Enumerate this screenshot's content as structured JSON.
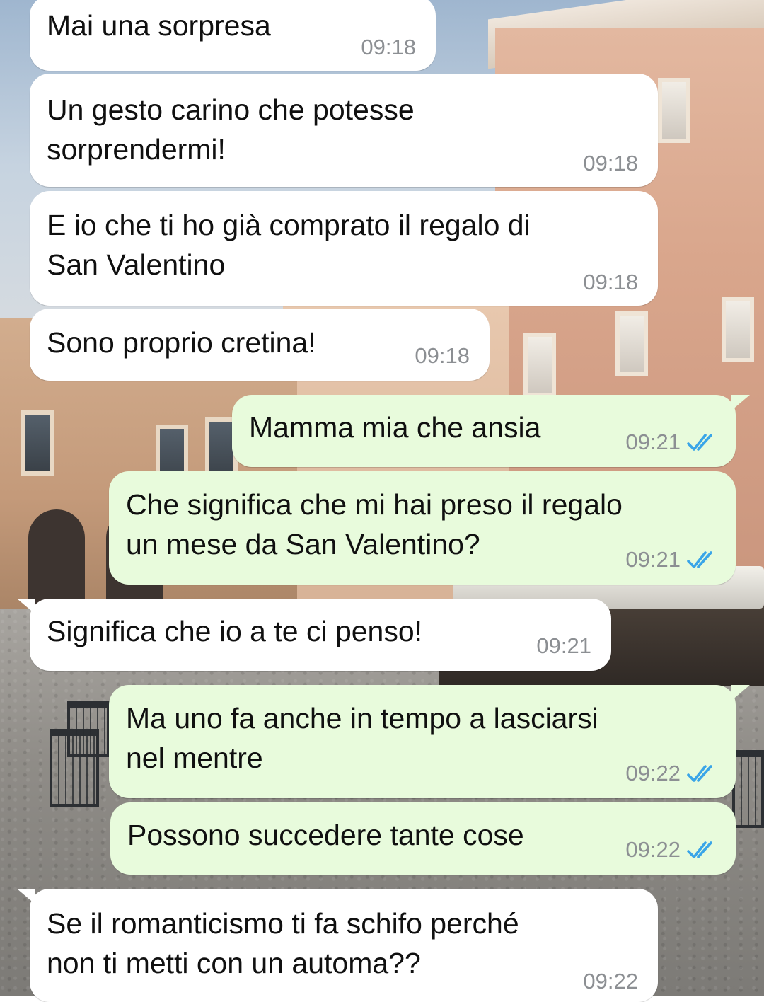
{
  "colors": {
    "incoming_bubble": "#ffffff",
    "outgoing_bubble": "#e8fbdc",
    "timestamp": "#8c8f93",
    "read_ticks": "#3aa5e8"
  },
  "messages": [
    {
      "direction": "in",
      "text": "Mai una sorpresa",
      "time": "09:18"
    },
    {
      "direction": "in",
      "text": "Un gesto carino che potesse\nsorprendermi!",
      "time": "09:18"
    },
    {
      "direction": "in",
      "text": "E io che ti ho già comprato il regalo di\nSan Valentino",
      "time": "09:18"
    },
    {
      "direction": "in",
      "text": "Sono proprio cretina!",
      "time": "09:18"
    },
    {
      "direction": "out",
      "text": "Mamma mia che ansia",
      "time": "09:21",
      "status_icon": "double-check-read-icon"
    },
    {
      "direction": "out",
      "text": "Che significa che mi hai preso il regalo\nun mese da San Valentino?",
      "time": "09:21",
      "status_icon": "double-check-read-icon"
    },
    {
      "direction": "in",
      "text": "Significa che io a te ci penso!",
      "time": "09:21"
    },
    {
      "direction": "out",
      "text": "Ma uno fa anche in tempo a lasciarsi\nnel mentre",
      "time": "09:22",
      "status_icon": "double-check-read-icon"
    },
    {
      "direction": "out",
      "text": "Possono succedere tante cose",
      "time": "09:22",
      "status_icon": "double-check-read-icon"
    },
    {
      "direction": "in",
      "text": "Se il romanticismo ti fa schifo perché\nnon ti metti con un automa??",
      "time": "09:22"
    }
  ]
}
